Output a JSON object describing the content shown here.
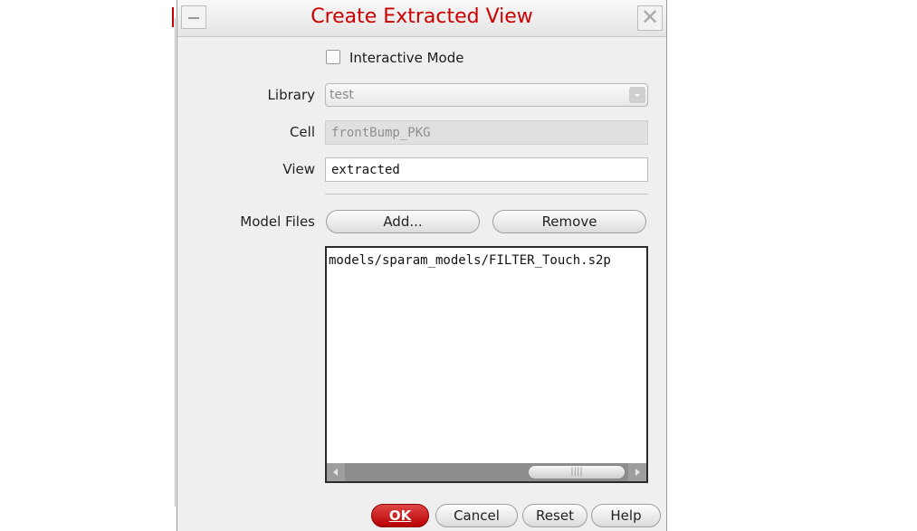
{
  "dialog": {
    "title": "Create Extracted View",
    "interactive_mode_label": "Interactive Mode",
    "interactive_mode_checked": false,
    "library_label": "Library",
    "library_value": "test",
    "cell_label": "Cell",
    "cell_value": "frontBump_PKG",
    "view_label": "View",
    "view_value": "extracted",
    "model_files_label": "Model Files",
    "add_label": "Add...",
    "remove_label": "Remove",
    "model_files": [
      "models/sparam_models/FILTER_Touch.s2p"
    ],
    "buttons": {
      "ok": "OK",
      "cancel": "Cancel",
      "reset": "Reset",
      "help": "Help"
    }
  },
  "icons": {
    "minimize": "minimize-icon",
    "close": "close-icon",
    "dropdown": "chevron-down-icon",
    "scroll_left": "scroll-left-icon",
    "scroll_right": "scroll-right-icon"
  },
  "colors": {
    "title": "#cc0000",
    "ok_button": "#c41a1a"
  }
}
